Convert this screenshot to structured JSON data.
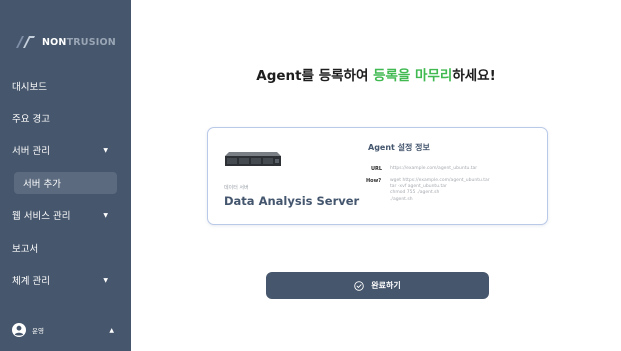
{
  "brand": {
    "name_bold": "NON",
    "name_rest": "TRUSION"
  },
  "sidebar": {
    "items": [
      {
        "label": "대시보드"
      },
      {
        "label": "주요 경고"
      },
      {
        "label": "서버 관리"
      },
      {
        "label": "서버 추가"
      },
      {
        "label": "웹 서비스 관리"
      },
      {
        "label": "보고서"
      },
      {
        "label": "체계 관리"
      }
    ],
    "user": {
      "label": "운영"
    }
  },
  "main": {
    "headline": {
      "part1": "Agent를 등록하여 ",
      "highlight": "등록을 마무리",
      "part2": "하세요!"
    },
    "card": {
      "server_category": "데이터 서버",
      "server_name": "Data Analysis Server",
      "config_title": "Agent 설정 정보",
      "url_label": "URL",
      "url_value": "https://example.com/agent_ubuntu.tar",
      "how_label": "How?",
      "how_lines": [
        "wget https://example.com/agent_ubuntu.tar",
        "tar -xvf agent_ubuntu.tar",
        "chmod 755 ./agent.sh",
        "./agent.sh"
      ]
    },
    "complete_button": {
      "label": "완료하기"
    }
  },
  "colors": {
    "sidebar_bg": "#46566c",
    "accent_green": "#3fb950",
    "card_border": "#b9c9e8",
    "button_bg": "#46566c"
  },
  "icons": {
    "logo": "nontrusion-logo-icon",
    "user": "user-circle-icon",
    "check": "check-circle-icon",
    "caret_down": "caret-down-icon",
    "caret_up": "caret-up-icon",
    "server": "rack-server-icon"
  }
}
